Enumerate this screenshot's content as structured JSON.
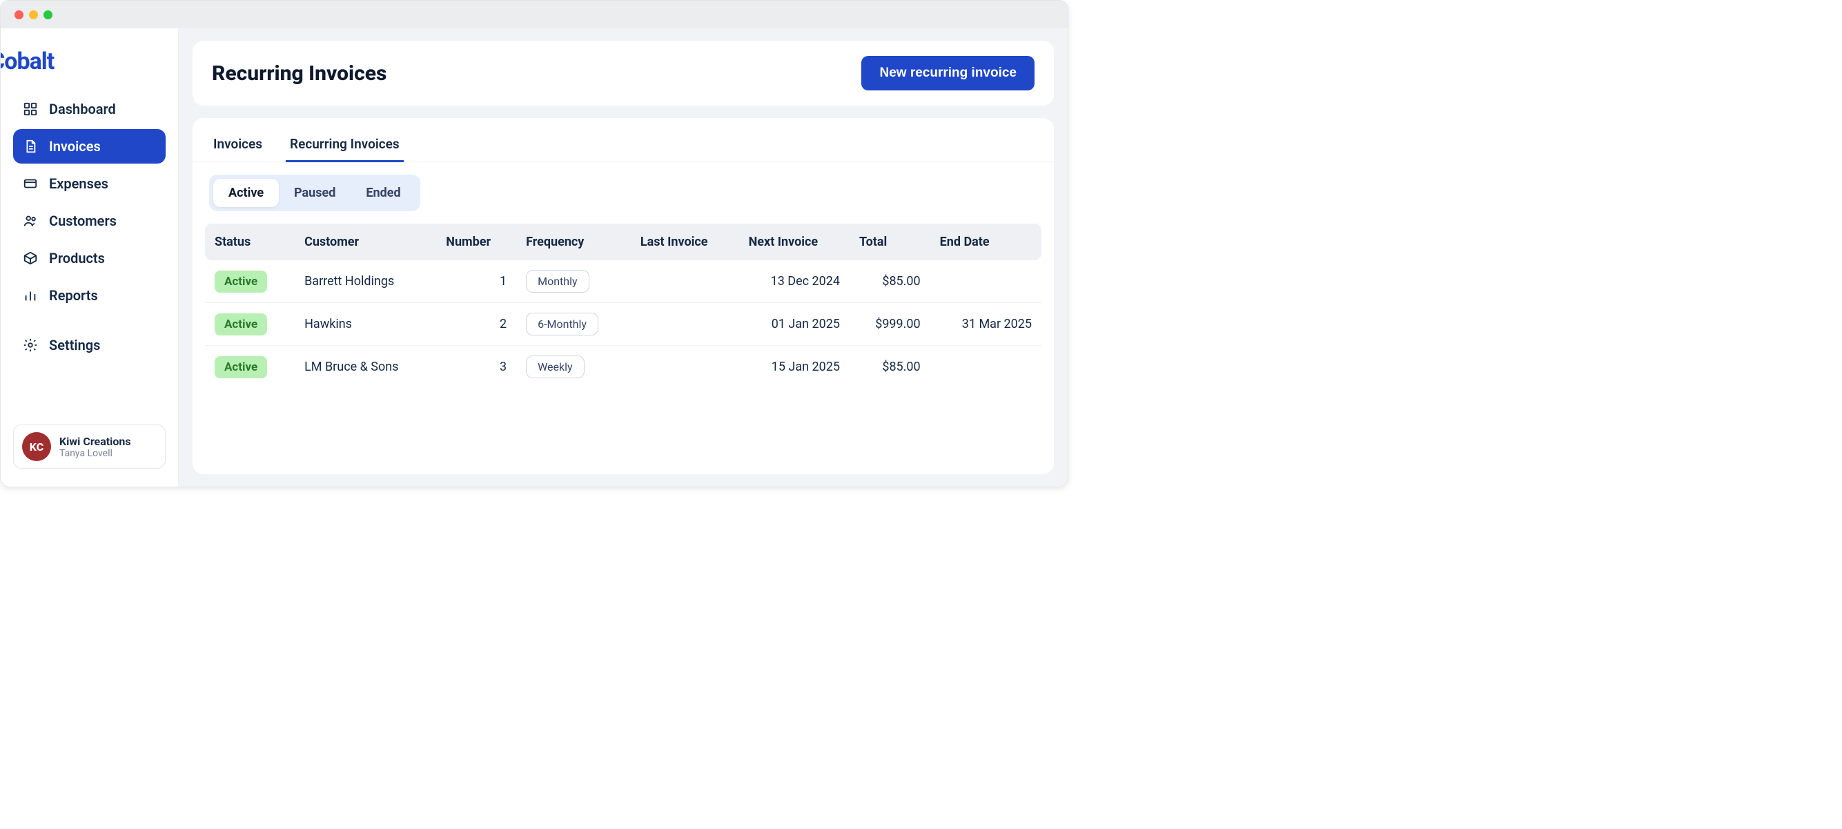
{
  "brand": {
    "name": "Cobalt"
  },
  "sidebar": {
    "items": [
      {
        "label": "Dashboard"
      },
      {
        "label": "Invoices"
      },
      {
        "label": "Expenses"
      },
      {
        "label": "Customers"
      },
      {
        "label": "Products"
      },
      {
        "label": "Reports"
      },
      {
        "label": "Settings"
      }
    ],
    "active_index": 1,
    "org": {
      "initials": "KC",
      "name": "Kiwi Creations",
      "user": "Tanya Lovell"
    }
  },
  "header": {
    "title": "Recurring Invoices",
    "primary_button": "New recurring invoice"
  },
  "tabs": {
    "items": [
      "Invoices",
      "Recurring Invoices"
    ],
    "active_index": 1
  },
  "segmented": {
    "items": [
      "Active",
      "Paused",
      "Ended"
    ],
    "active_index": 0
  },
  "table": {
    "columns": [
      "Status",
      "Customer",
      "Number",
      "Frequency",
      "Last Invoice",
      "Next Invoice",
      "Total",
      "End Date"
    ],
    "rows": [
      {
        "status": "Active",
        "customer": "Barrett Holdings",
        "number": "1",
        "frequency": "Monthly",
        "last_invoice": "",
        "next_invoice": "13 Dec 2024",
        "total": "$85.00",
        "end_date": ""
      },
      {
        "status": "Active",
        "customer": "Hawkins",
        "number": "2",
        "frequency": "6-Monthly",
        "last_invoice": "",
        "next_invoice": "01 Jan 2025",
        "total": "$999.00",
        "end_date": "31 Mar 2025"
      },
      {
        "status": "Active",
        "customer": "LM Bruce & Sons",
        "number": "3",
        "frequency": "Weekly",
        "last_invoice": "",
        "next_invoice": "15 Jan 2025",
        "total": "$85.00",
        "end_date": ""
      }
    ]
  },
  "colors": {
    "accent": "#1f47c8",
    "status_active_bg": "#b8efb2",
    "status_active_fg": "#2a7a2e"
  }
}
